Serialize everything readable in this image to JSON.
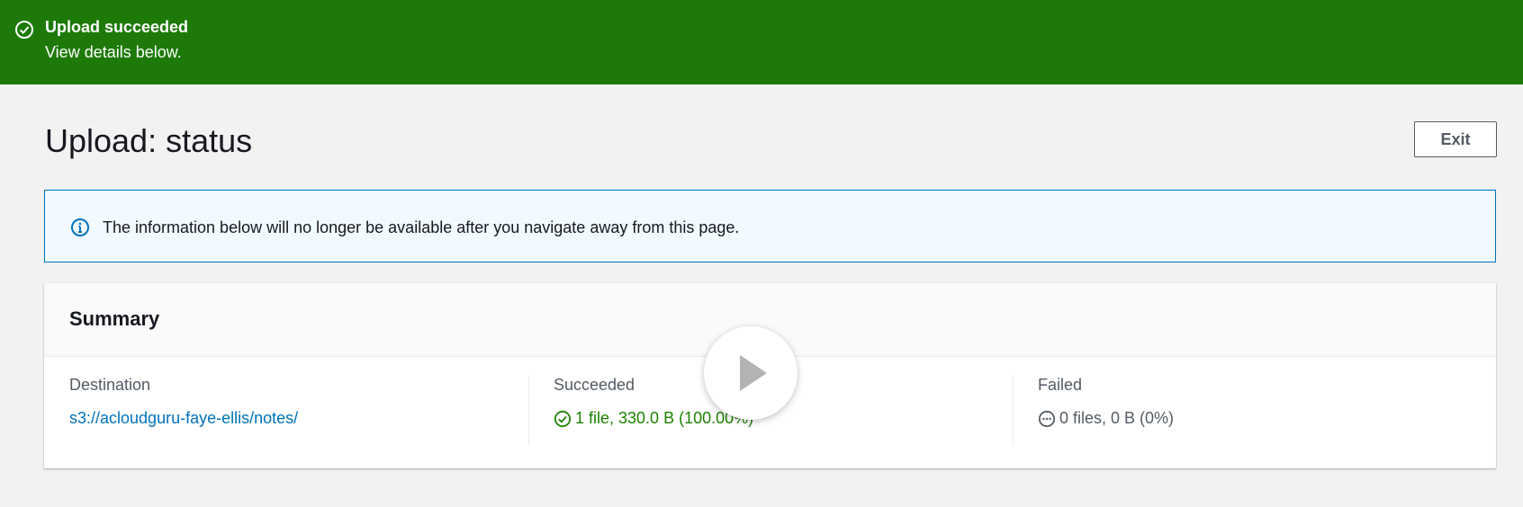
{
  "flash": {
    "title": "Upload succeeded",
    "message": "View details below.",
    "icon": "check-circle-icon",
    "color": "#1d7a09"
  },
  "header": {
    "title": "Upload: status",
    "exit_label": "Exit"
  },
  "info_alert": {
    "icon": "info-icon",
    "text": "The information below will no longer be available after you navigate away from this page."
  },
  "summary": {
    "title": "Summary",
    "destination": {
      "label": "Destination",
      "value": "s3://acloudguru-faye-ellis/notes/"
    },
    "succeeded": {
      "label": "Succeeded",
      "value": "1 file, 330.0 B (100.00%)",
      "icon": "check-circle-icon",
      "color": "#1d8102"
    },
    "failed": {
      "label": "Failed",
      "value": "0 files, 0 B (0%)",
      "icon": "ellipsis-circle-icon"
    }
  },
  "video_overlay": {
    "icon": "play-icon"
  }
}
